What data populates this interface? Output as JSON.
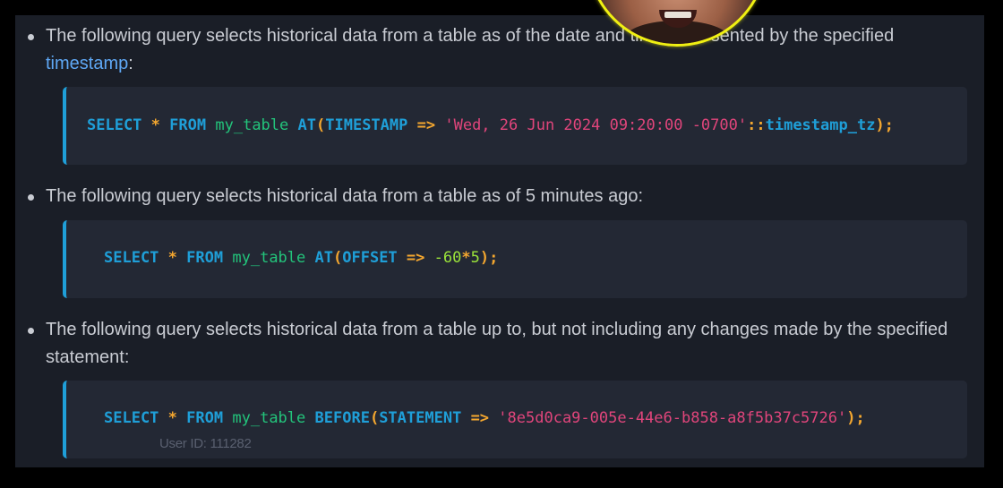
{
  "bullets": [
    {
      "text_before": "The following query selects historical data from a table as of the date and time represented by the specified ",
      "link": "timestamp",
      "text_after": ":"
    },
    {
      "text": "The following query selects historical data from a table as of 5 minutes ago:"
    },
    {
      "text": "The following query selects historical data from a table up to, but not including any changes made by the specified statement:"
    }
  ],
  "code_blocks": [
    {
      "tokens": [
        {
          "t": "SELECT",
          "c": "kw"
        },
        {
          "t": " ",
          "c": ""
        },
        {
          "t": "*",
          "c": "op"
        },
        {
          "t": " ",
          "c": ""
        },
        {
          "t": "FROM",
          "c": "kw"
        },
        {
          "t": " ",
          "c": ""
        },
        {
          "t": "my_table",
          "c": "id"
        },
        {
          "t": " ",
          "c": ""
        },
        {
          "t": "AT",
          "c": "kw"
        },
        {
          "t": "(",
          "c": "op"
        },
        {
          "t": "TIMESTAMP",
          "c": "kw"
        },
        {
          "t": " ",
          "c": ""
        },
        {
          "t": "=>",
          "c": "op"
        },
        {
          "t": " ",
          "c": ""
        },
        {
          "t": "'Wed, 26 Jun 2024 09:20:00 -0700'",
          "c": "str"
        },
        {
          "t": "::",
          "c": "op"
        },
        {
          "t": "timestamp_tz",
          "c": "kw"
        },
        {
          "t": ");",
          "c": "op"
        }
      ]
    },
    {
      "tokens": [
        {
          "t": "SELECT",
          "c": "kw"
        },
        {
          "t": " ",
          "c": ""
        },
        {
          "t": "*",
          "c": "op"
        },
        {
          "t": " ",
          "c": ""
        },
        {
          "t": "FROM",
          "c": "kw"
        },
        {
          "t": " ",
          "c": ""
        },
        {
          "t": "my_table",
          "c": "id"
        },
        {
          "t": " ",
          "c": ""
        },
        {
          "t": "AT",
          "c": "kw"
        },
        {
          "t": "(",
          "c": "op"
        },
        {
          "t": "OFFSET",
          "c": "kw"
        },
        {
          "t": " ",
          "c": ""
        },
        {
          "t": "=>",
          "c": "op"
        },
        {
          "t": " ",
          "c": ""
        },
        {
          "t": "-60",
          "c": "num"
        },
        {
          "t": "*",
          "c": "op"
        },
        {
          "t": "5",
          "c": "num"
        },
        {
          "t": ");",
          "c": "op"
        }
      ]
    },
    {
      "tokens": [
        {
          "t": "SELECT",
          "c": "kw"
        },
        {
          "t": " ",
          "c": ""
        },
        {
          "t": "*",
          "c": "op"
        },
        {
          "t": " ",
          "c": ""
        },
        {
          "t": "FROM",
          "c": "kw"
        },
        {
          "t": " ",
          "c": ""
        },
        {
          "t": "my_table",
          "c": "id"
        },
        {
          "t": " ",
          "c": ""
        },
        {
          "t": "BEFORE",
          "c": "kw"
        },
        {
          "t": "(",
          "c": "op"
        },
        {
          "t": "STATEMENT",
          "c": "kw"
        },
        {
          "t": " ",
          "c": ""
        },
        {
          "t": "=>",
          "c": "op"
        },
        {
          "t": " ",
          "c": ""
        },
        {
          "t": "'8e5d0ca9-005e-44e6-b858-a8f5b37c5726'",
          "c": "str"
        },
        {
          "t": ");",
          "c": "op"
        }
      ]
    }
  ],
  "watermark": "User ID: 111282",
  "colors": {
    "background": "#000000",
    "panel": "#1a1e27",
    "code_bg": "#232834",
    "accent_bar": "#1f9fd8",
    "keyword": "#1f9fd8",
    "operator": "#f4a72f",
    "identifier": "#23c47b",
    "string": "#e0457b",
    "number": "#9be33a",
    "link": "#5fa8f5",
    "avatar_ring": "#f0f012"
  },
  "avatar": {
    "icon": "webcam-presenter-avatar"
  }
}
